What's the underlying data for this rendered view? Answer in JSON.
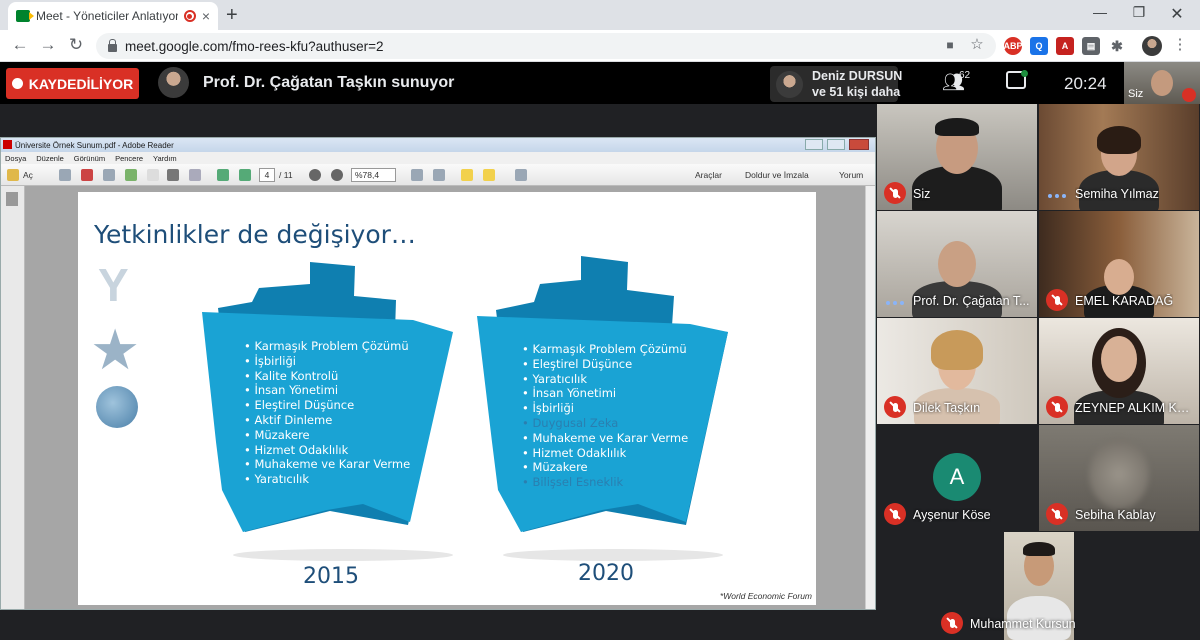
{
  "browser": {
    "tab_title": "Meet - Yöneticiler Anlatıyor: ",
    "url": "meet.google.com/fmo-rees-kfu?authuser=2",
    "new_tab_symbol": "+",
    "close_symbol": "×"
  },
  "meet": {
    "recording_label": "KAYDEDİLİYOR",
    "presenter_label": "Prof. Dr. Çağatan Taşkın sunuyor",
    "presenter_popup": {
      "name": "Deniz DURSUN",
      "others": "ve 51 kişi daha"
    },
    "participant_count": "62",
    "time": "20:24",
    "self_label": "Siz"
  },
  "reader": {
    "window_title": "Üniversite Örnek Sunum.pdf - Adobe Reader",
    "menu": [
      "Dosya",
      "Düzenle",
      "Görünüm",
      "Pencere",
      "Yardım"
    ],
    "open_label": "Aç",
    "page_current": "4",
    "page_total": "/ 11",
    "zoom": "%78,4",
    "tools_label": "Araçlar",
    "fill_sign_label": "Doldur ve İmzala",
    "comment_label": "Yorum"
  },
  "slide": {
    "title": "Yetkinlikler de değişiyor…",
    "list_2015": [
      "Karmaşık Problem Çözümü",
      "İşbirliği",
      "Kalite Kontrolü",
      "İnsan Yönetimi",
      "Eleştirel Düşünce",
      "Aktif Dinleme",
      "Müzakere",
      "Hizmet Odaklılık",
      "Muhakeme ve Karar Verme",
      "Yaratıcılık"
    ],
    "list_2020": [
      "Karmaşık Problem Çözümü",
      "Eleştirel Düşünce",
      "Yaratıcılık",
      "İnsan Yönetimi",
      "İşbirliği",
      "Duygusal Zeka",
      "Muhakeme ve Karar Verme",
      "Hizmet Odaklılık",
      "Müzakere",
      "Bilişsel Esneklik"
    ],
    "year_left": "2015",
    "year_right": "2020",
    "source": "*World Economic Forum",
    "colors": {
      "banner": "#1aa3d4",
      "banner_dark": "#0f7fb0",
      "title": "#1e4e79"
    }
  },
  "participants": [
    {
      "name": "Siz",
      "muted": true
    },
    {
      "name": "Semiha Yılmaz",
      "muted": false
    },
    {
      "name": "Prof. Dr. Çağatan T...",
      "muted": false
    },
    {
      "name": "EMEL KARADAĞ",
      "muted": true
    },
    {
      "name": "Dilek Taşkın",
      "muted": true
    },
    {
      "name": "ZEYNEP ALKIM KA...",
      "muted": true
    },
    {
      "name": "Ayşenur Köse",
      "muted": true,
      "initial": "A"
    },
    {
      "name": "Sebiha Kablay",
      "muted": true
    },
    {
      "name": "Muhammet Kursun",
      "muted": true
    }
  ]
}
